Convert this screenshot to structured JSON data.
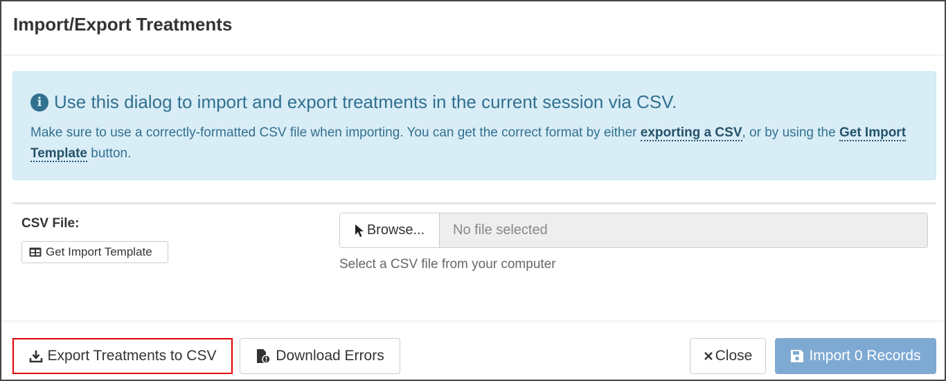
{
  "dialog": {
    "title": "Import/Export Treatments"
  },
  "info": {
    "icon": "info-circle-icon",
    "heading": "Use this dialog to import and export treatments in the current session via CSV.",
    "text_part1": "Make sure to use a correctly-formatted CSV file when importing. You can get the correct format by either ",
    "link_export": "exporting a CSV",
    "text_part2": ", or by using the ",
    "link_template": "Get Import Template",
    "text_part3": " button."
  },
  "csv": {
    "label": "CSV File:",
    "template_button": "Get Import Template",
    "browse_button": "Browse...",
    "file_placeholder": "No file selected",
    "help_text": "Select a CSV file from your computer"
  },
  "footer": {
    "export_button": "Export Treatments to CSV",
    "download_errors_button": "Download Errors",
    "close_button": "Close",
    "import_button": "Import 0 Records"
  },
  "colors": {
    "info_bg": "#d9edf7",
    "info_text": "#31708f",
    "import_button_bg": "#7ea9d3",
    "highlight_border": "#e00000"
  }
}
